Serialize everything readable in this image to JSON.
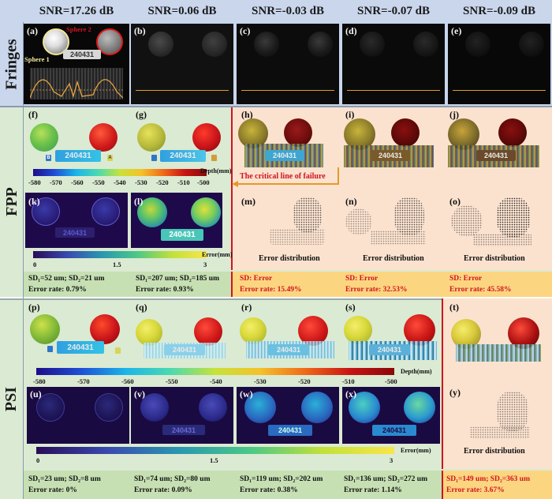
{
  "headers": [
    "SNR=17.26 dB",
    "SNR=0.06 dB",
    "SNR=-0.03 dB",
    "SNR=-0.07 dB",
    "SNR=-0.09 dB"
  ],
  "rows": [
    "Fringes",
    "FPP",
    "PSI"
  ],
  "panel_labels": {
    "a": "(a)",
    "b": "(b)",
    "c": "(c)",
    "d": "(d)",
    "e": "(e)",
    "f": "(f)",
    "g": "(g)",
    "h": "(h)",
    "i": "(i)",
    "j": "(j)",
    "k": "(k)",
    "l": "(l)",
    "m": "(m)",
    "n": "(n)",
    "o": "(o)",
    "p": "(p)",
    "q": "(q)",
    "r": "(r)",
    "s": "(s)",
    "t": "(t)",
    "u": "(u)",
    "v": "(v)",
    "w": "(w)",
    "x": "(x)",
    "y": "(y)"
  },
  "sphere_labels": {
    "s1": "Sphere 1",
    "s2": "Sphere 2"
  },
  "plate_text": "240431",
  "tags": {
    "b": "B",
    "a": "A"
  },
  "fpp": {
    "depth_ticks": [
      "-580",
      "-570",
      "-560",
      "-550",
      "-540",
      "-530",
      "-520",
      "-510",
      "-500"
    ],
    "depth_unit": "Depth(mm)",
    "error_ticks": [
      "0",
      "1.5",
      "3"
    ],
    "error_unit": "Error(mm)",
    "critical_line": "The critical line of failure",
    "error_distribution": "Error distribution",
    "stats": [
      {
        "sd": "SD₁=52 um; SD₂=21 um",
        "rate": "Error rate: 0.79%"
      },
      {
        "sd": "SD₁=207 um; SD₂=185 um",
        "rate": "Error rate: 0.93%"
      },
      {
        "sd": "SD: Error",
        "rate": "Error rate: 15.49%"
      },
      {
        "sd": "SD: Error",
        "rate": "Error rate: 32.53%"
      },
      {
        "sd": "SD: Error",
        "rate": "Error rate: 45.58%"
      }
    ]
  },
  "psi": {
    "depth_ticks": [
      "-580",
      "-570",
      "-560",
      "-550",
      "-540",
      "-530",
      "-520",
      "-510",
      "-500"
    ],
    "depth_unit": "Depth(mm)",
    "error_ticks": [
      "0",
      "1.5",
      "3"
    ],
    "error_unit": "Error(mm)",
    "error_distribution": "Error distribution",
    "stats": [
      {
        "sd": "SD₁=23 um; SD₂=8 um",
        "rate": "Error rate: 0%"
      },
      {
        "sd": "SD₁=74 um; SD₂=80 um",
        "rate": "Error rate: 0.09%"
      },
      {
        "sd": "SD₁=119 um; SD₂=202 um",
        "rate": "Error rate: 0.38%"
      },
      {
        "sd": "SD₁=136 um; SD₂=272 um",
        "rate": "Error rate: 1.14%"
      },
      {
        "sd": "SD₁=149 um; SD₂=363 um",
        "rate": "Error rate: 3.67%"
      }
    ]
  },
  "colors": {
    "header_bg": "#c9d6ec",
    "fringes_bg": "#c9d6ec",
    "fpp_bg": "#dbead2",
    "psi_bg": "#dbead2",
    "fail_bg": "#fbe2cf",
    "stats_green": "#c6e0b4",
    "stats_yellow": "#fcd581",
    "critical_red": "#d0141e"
  }
}
